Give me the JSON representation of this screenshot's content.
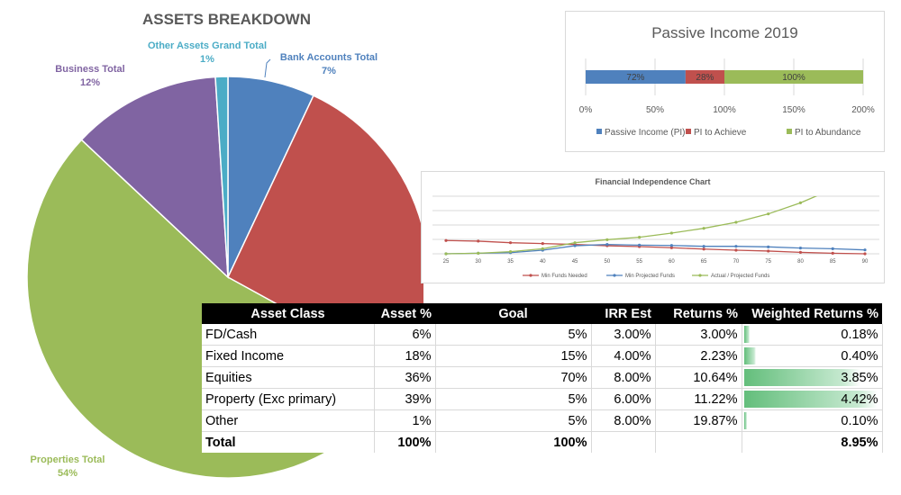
{
  "chart_data": [
    {
      "type": "pie",
      "title": "ASSETS BREAKDOWN",
      "slices": [
        {
          "name": "Bank Accounts Total",
          "value": 7,
          "label": "7%",
          "color": "#4f81bd"
        },
        {
          "name": "",
          "value": 26,
          "label": "",
          "color": "#c0504d"
        },
        {
          "name": "Properties Total",
          "value": 54,
          "label": "54%",
          "color": "#9bbb59"
        },
        {
          "name": "Business Total",
          "value": 12,
          "label": "12%",
          "color": "#8064a2"
        },
        {
          "name": "Other Assets Grand Total",
          "value": 1,
          "label": "1%",
          "color": "#4bacc6"
        }
      ]
    },
    {
      "type": "bar",
      "orientation": "horizontal-stacked",
      "title": "Passive Income 2019",
      "xlim": [
        0,
        200
      ],
      "xticks": [
        "0%",
        "50%",
        "100%",
        "150%",
        "200%"
      ],
      "series": [
        {
          "name": "Passive Income (PI)",
          "value": 72,
          "label": "72%",
          "color": "#4f81bd"
        },
        {
          "name": "PI to Achieve",
          "value": 28,
          "label": "28%",
          "color": "#c0504d"
        },
        {
          "name": "PI to Abundance",
          "value": 100,
          "label": "100%",
          "color": "#9bbb59"
        }
      ],
      "legend": "bottom",
      "grid": true
    },
    {
      "type": "line",
      "title": "Financial Independence Chart",
      "x": [
        25,
        30,
        35,
        40,
        45,
        50,
        55,
        60,
        65,
        70,
        75,
        80,
        85,
        90
      ],
      "ylim": [
        0,
        4
      ],
      "grid": true,
      "legend": "bottom",
      "series": [
        {
          "name": "Min Funds Needed",
          "color": "#c0504d",
          "values": [
            0.92,
            0.88,
            0.77,
            0.71,
            0.65,
            0.56,
            0.5,
            0.42,
            0.33,
            0.25,
            0.19,
            0.1,
            0.04,
            0
          ]
        },
        {
          "name": "Min Projected Funds",
          "color": "#4f81bd",
          "values": [
            0,
            0.04,
            0.08,
            0.25,
            0.56,
            0.65,
            0.6,
            0.58,
            0.52,
            0.52,
            0.48,
            0.4,
            0.35,
            0.27
          ]
        },
        {
          "name": "Actual / Projected Funds",
          "color": "#9bbb59",
          "values": [
            0,
            0.04,
            0.15,
            0.35,
            0.77,
            0.98,
            1.15,
            1.44,
            1.77,
            2.19,
            2.77,
            3.54,
            4.5,
            5.5
          ]
        }
      ]
    }
  ],
  "table": {
    "headers": [
      "Asset Class",
      "Asset %",
      "Goal",
      "IRR Est",
      "Returns %",
      "Weighted Returns %"
    ],
    "rows": [
      {
        "c": [
          "FD/Cash",
          "6%",
          "5%",
          "3.00%",
          "3.00%",
          "0.18%"
        ],
        "w": 0.18
      },
      {
        "c": [
          "Fixed Income",
          "18%",
          "15%",
          "4.00%",
          "2.23%",
          "0.40%"
        ],
        "w": 0.4
      },
      {
        "c": [
          "Equities",
          "36%",
          "70%",
          "8.00%",
          "10.64%",
          "3.85%"
        ],
        "w": 3.85
      },
      {
        "c": [
          "Property (Exc primary)",
          "39%",
          "5%",
          "6.00%",
          "11.22%",
          "4.42%"
        ],
        "w": 4.42
      },
      {
        "c": [
          "Other",
          "1%",
          "5%",
          "8.00%",
          "19.87%",
          "0.10%"
        ],
        "w": 0.1
      }
    ],
    "total": [
      "Total",
      "100%",
      "100%",
      "",
      "",
      "8.95%"
    ]
  }
}
